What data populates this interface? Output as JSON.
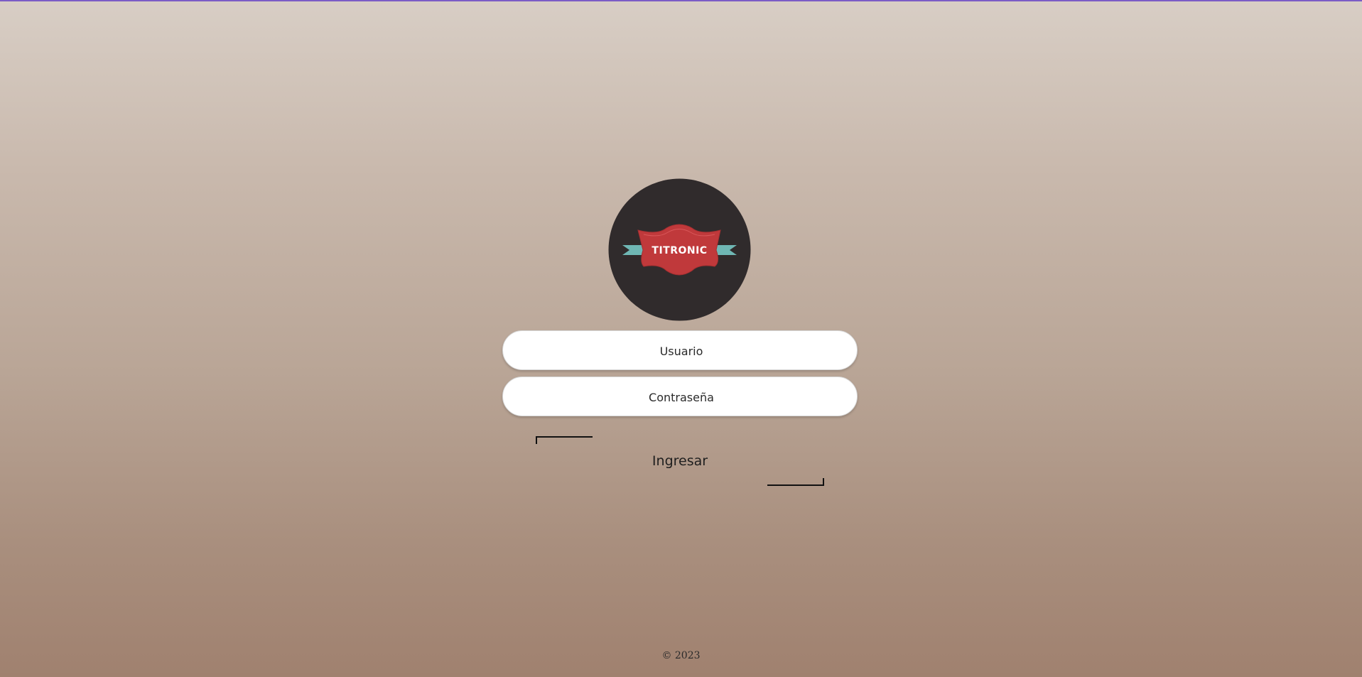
{
  "logo": {
    "brand_text": "TITRONIC",
    "colors": {
      "circle": "#302b2c",
      "badge": "#c0393b",
      "ribbon": "#6fb7b4"
    }
  },
  "form": {
    "username_placeholder": "Usuario",
    "password_placeholder": "Contraseña",
    "submit_label": "Ingresar"
  },
  "footer": {
    "copyright": "© 2023"
  },
  "colors": {
    "accent_top_line": "#7b5cc6",
    "background_top": "#d8cec5",
    "background_bottom": "#a0816f"
  }
}
